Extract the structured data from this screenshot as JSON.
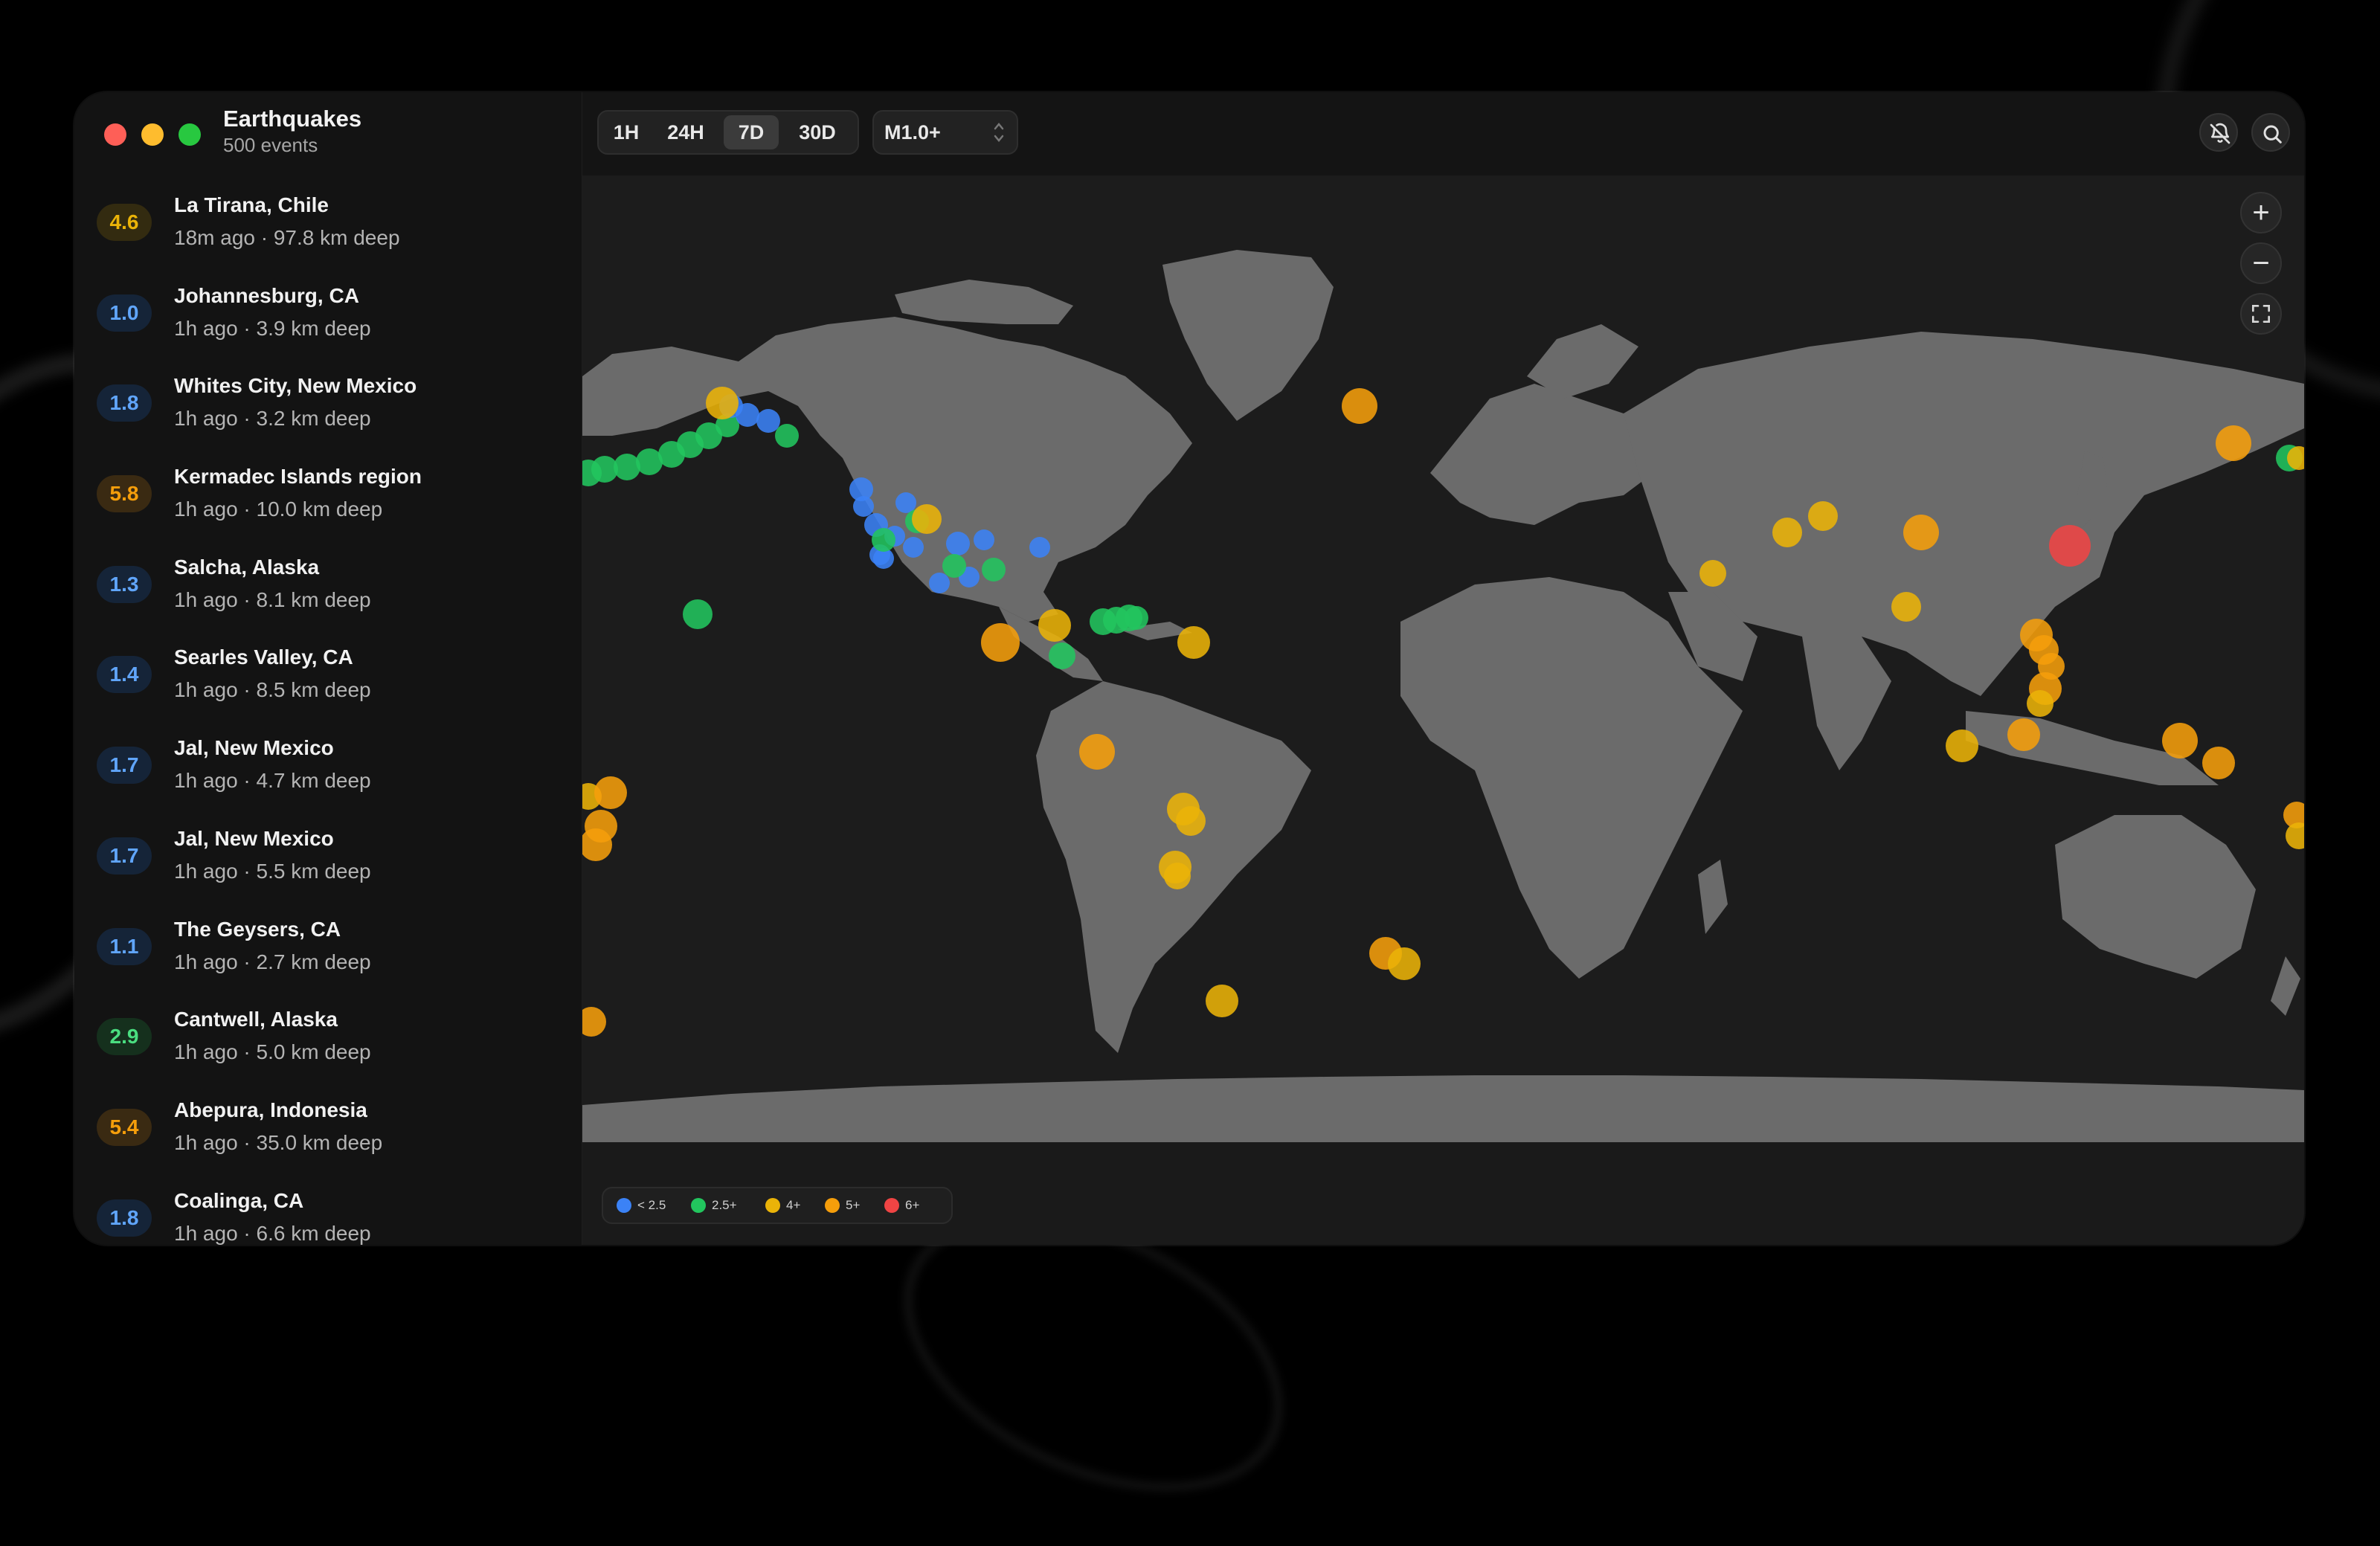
{
  "app": {
    "title": "Earthquakes",
    "subtitle": "500 events"
  },
  "toolbar": {
    "ranges": [
      {
        "label": "1H",
        "active": false
      },
      {
        "label": "24H",
        "active": false
      },
      {
        "label": "7D",
        "active": true
      },
      {
        "label": "30D",
        "active": false
      }
    ],
    "magnitude_filter": "M1.0+",
    "icons": [
      "bell-off-icon",
      "search-icon"
    ]
  },
  "map_controls": {
    "zoom_in": "+",
    "zoom_out": "−",
    "fullscreen_icon": "fullscreen-icon"
  },
  "events": [
    {
      "mag": "4.6",
      "place": "La Tirana, Chile",
      "meta": "18m ago · 97.8 km deep"
    },
    {
      "mag": "1.0",
      "place": "Johannesburg, CA",
      "meta": "1h ago · 3.9 km deep"
    },
    {
      "mag": "1.8",
      "place": "Whites City, New Mexico",
      "meta": "1h ago · 3.2 km deep"
    },
    {
      "mag": "5.8",
      "place": "Kermadec Islands region",
      "meta": "1h ago · 10.0 km deep"
    },
    {
      "mag": "1.3",
      "place": "Salcha, Alaska",
      "meta": "1h ago · 8.1 km deep"
    },
    {
      "mag": "1.4",
      "place": "Searles Valley, CA",
      "meta": "1h ago · 8.5 km deep"
    },
    {
      "mag": "1.7",
      "place": "Jal, New Mexico",
      "meta": "1h ago · 4.7 km deep"
    },
    {
      "mag": "1.7",
      "place": "Jal, New Mexico",
      "meta": "1h ago · 5.5 km deep"
    },
    {
      "mag": "1.1",
      "place": "The Geysers, CA",
      "meta": "1h ago · 2.7 km deep"
    },
    {
      "mag": "2.9",
      "place": "Cantwell, Alaska",
      "meta": "1h ago · 5.0 km deep"
    },
    {
      "mag": "5.4",
      "place": "Abepura, Indonesia",
      "meta": "1h ago · 35.0 km deep"
    },
    {
      "mag": "1.8",
      "place": "Coalinga, CA",
      "meta": "1h ago · 6.6 km deep"
    }
  ],
  "legend": [
    {
      "label": "< 2.5",
      "color": "#3b82f6"
    },
    {
      "label": "2.5+",
      "color": "#22c55e"
    },
    {
      "label": "4+",
      "color": "#eab308"
    },
    {
      "label": "5+",
      "color": "#f59e0b"
    },
    {
      "label": "6+",
      "color": "#ef4444"
    }
  ],
  "colors": {
    "blue": "#3b82f6",
    "green": "#22c55e",
    "yellow": "#eab308",
    "orange": "#f59e0b",
    "red": "#ef4444",
    "land": "#6b6b6b",
    "ocean": "#1c1c1c"
  }
}
